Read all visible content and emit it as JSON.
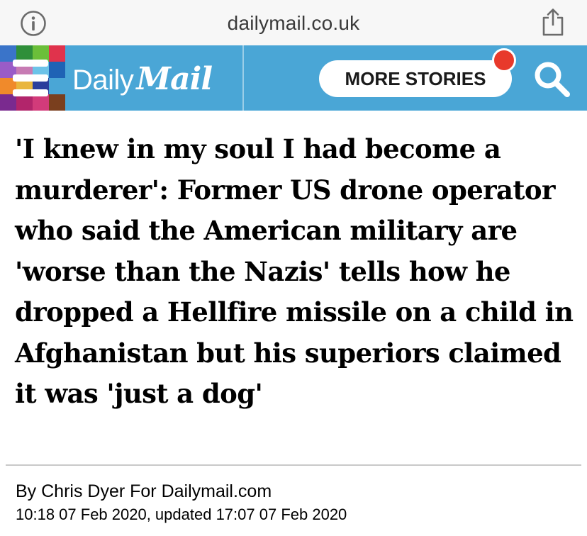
{
  "browser": {
    "url": "dailymail.co.uk",
    "icons": {
      "info": "info-icon",
      "share": "share-icon"
    }
  },
  "header": {
    "brand_daily": "Daily",
    "brand_mail": "Mail",
    "more_stories_label": "MORE STORIES",
    "colors": {
      "header_bg": "#4aa6d6",
      "notification": "#e8392b",
      "mosaic": [
        "#3a74c9",
        "#2f8f3a",
        "#6bbf3a",
        "#e0334c",
        "#9a5cc7",
        "#c77bb3",
        "#6cc3e8",
        "#1f63b5",
        "#f08a2b",
        "#e9b63e",
        "#2b3e9c",
        "#4aa6d6",
        "#7a2a8f",
        "#b2256b",
        "#d23b7a",
        "#7a3f1e"
      ]
    },
    "icons": {
      "menu": "menu-icon",
      "search": "search-icon"
    }
  },
  "article": {
    "headline": "'I knew in my soul I had become a murderer': Former US drone operator who said the American military are 'worse than the Nazis' tells how he dropped a Hellfire missile on a child in Afghanistan but his superiors claimed it was 'just a dog'",
    "byline": "By Chris Dyer For Dailymail.com",
    "timestamp": "10:18 07 Feb 2020, updated 17:07 07 Feb 2020"
  }
}
